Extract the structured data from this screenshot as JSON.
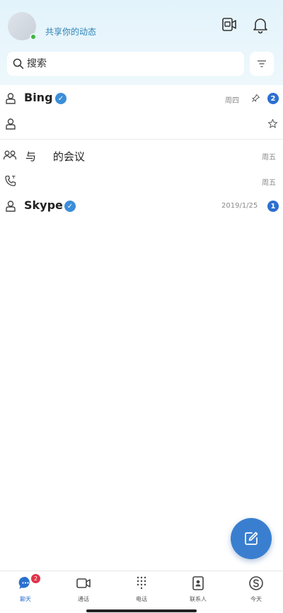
{
  "header": {
    "status_text": "共享你的动态"
  },
  "search": {
    "placeholder": "搜索"
  },
  "chats": [
    {
      "name": "Bing",
      "verified": true,
      "date": "周四",
      "unread": "2",
      "pinned": true
    },
    {
      "name": "",
      "date": "",
      "favorite": true
    },
    {
      "name": "与     的会议",
      "date": "周五"
    },
    {
      "name": "",
      "date": "周五"
    },
    {
      "name": "Skype",
      "verified": true,
      "date": "2019/1/25",
      "unread": "1"
    }
  ],
  "nav": {
    "chats": {
      "label": "聊天",
      "badge": "2"
    },
    "calls": {
      "label": "通话"
    },
    "dialpad": {
      "label": "电话"
    },
    "contacts": {
      "label": "联系人"
    },
    "today": {
      "label": "今天"
    }
  },
  "colors": {
    "accent": "#2d6fd1",
    "header_bg": "#e3f3fb",
    "presence": "#3fb43f",
    "nav_badge": "#e0334a"
  }
}
